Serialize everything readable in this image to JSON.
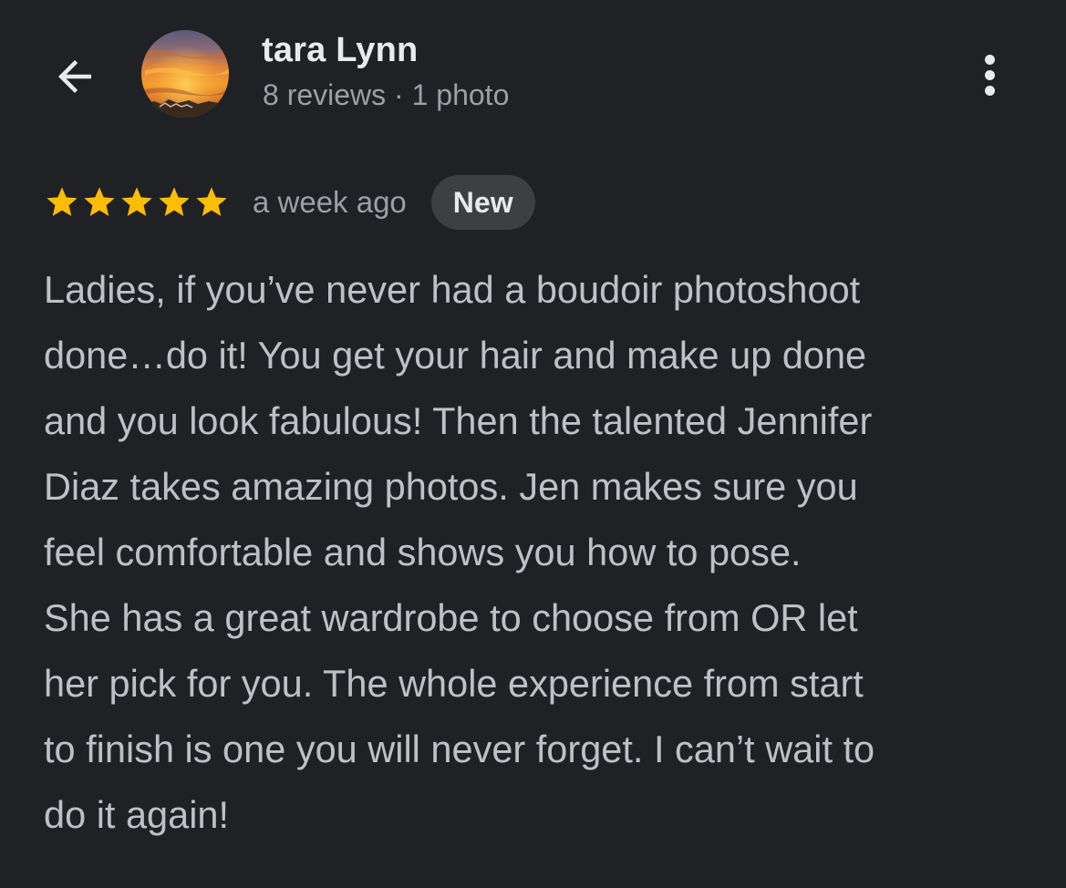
{
  "header": {
    "back_icon": "arrow-back-icon",
    "user_name": "tara Lynn",
    "user_meta": "8 reviews · 1 photo",
    "avatar_icon": "sunset-avatar",
    "more_icon": "more-vert-icon"
  },
  "review": {
    "rating": 5,
    "rating_max": 5,
    "star_color": "#fbbc04",
    "time_ago": "a week ago",
    "badge": "New",
    "text_lines": [
      "Ladies, if you’ve never had a boudoir photoshoot",
      "done…do it! You get your hair and make up done",
      "and you look fabulous! Then the talented Jennifer",
      "Diaz takes amazing photos. Jen makes sure you",
      "feel comfortable and shows you how to pose.",
      "She has a great wardrobe to choose from OR let",
      "her pick for you. The whole experience from start",
      "to finish is one you will never forget. I can’t wait to",
      "do it again!"
    ]
  },
  "colors": {
    "background": "#202124",
    "name_text": "#e8eaed",
    "secondary_text": "#9aa0a6",
    "body_text": "#bdc1c6",
    "badge_bg": "#3c4043"
  }
}
